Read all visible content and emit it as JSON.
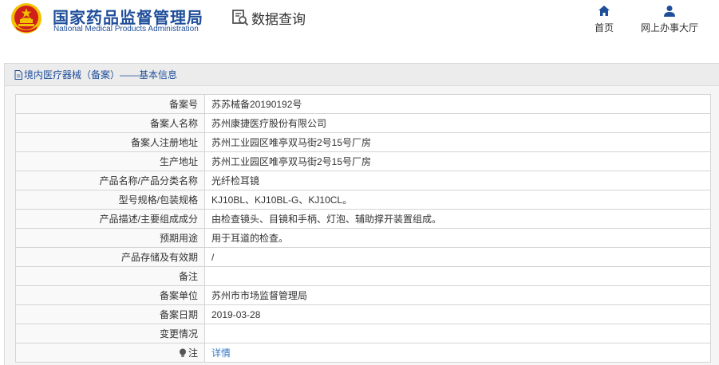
{
  "header": {
    "org_cn": "国家药品监督管理局",
    "org_en": "National Medical Products Administration",
    "query_label": "数据查询",
    "nav_home": "首页",
    "nav_hall": "网上办事大厅"
  },
  "panel": {
    "title": "境内医疗器械（备案）——基本信息"
  },
  "rows": [
    {
      "key": "备案号",
      "value": "苏苏械备20190192号"
    },
    {
      "key": "备案人名称",
      "value": "苏州康捷医疗股份有限公司"
    },
    {
      "key": "备案人注册地址",
      "value": "苏州工业园区唯亭双马街2号15号厂房"
    },
    {
      "key": "生产地址",
      "value": "苏州工业园区唯亭双马街2号15号厂房"
    },
    {
      "key": "产品名称/产品分类名称",
      "value": "光纤检耳镜"
    },
    {
      "key": "型号规格/包装规格",
      "value": "KJ10BL、KJ10BL-G、KJ10CL。"
    },
    {
      "key": "产品描述/主要组成成分",
      "value": "由检查镜头、目镜和手柄、灯泡、辅助撑开装置组成。"
    },
    {
      "key": "预期用途",
      "value": "用于耳道的检查。"
    },
    {
      "key": "产品存储及有效期",
      "value": "/"
    },
    {
      "key": "备注",
      "value": ""
    },
    {
      "key": "备案单位",
      "value": "苏州市市场监督管理局"
    },
    {
      "key": "备案日期",
      "value": "2019-03-28"
    },
    {
      "key": "变更情况",
      "value": ""
    }
  ],
  "note_row": {
    "key": "注",
    "link": "详情"
  },
  "colors": {
    "brand_blue": "#1f4e9a",
    "link_blue": "#3477c4",
    "emblem_red": "#d0201a",
    "emblem_gold": "#f2c200"
  }
}
